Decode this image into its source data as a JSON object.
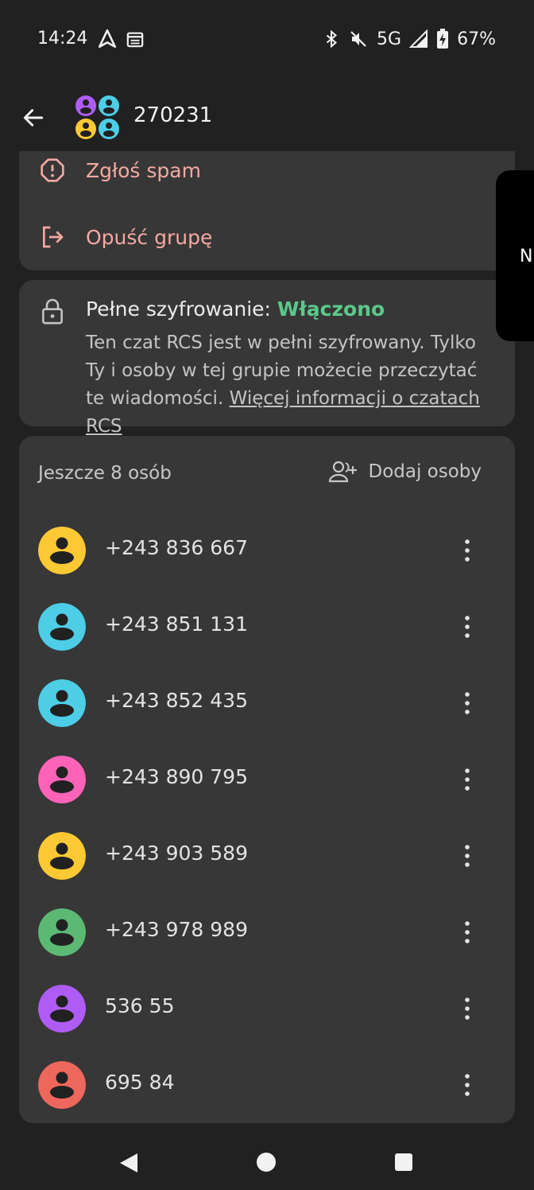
{
  "status_bar": {
    "time": "14:24",
    "network": "5G",
    "battery": "67%",
    "icons": [
      "navigation-arrow-icon",
      "calendar-icon",
      "bluetooth-icon",
      "vibrate-off-icon",
      "signal-icon",
      "battery-charging-icon"
    ]
  },
  "app_bar": {
    "title": "270231",
    "back_icon": "arrow-left-icon"
  },
  "menu": {
    "report_spam": "Zgłoś spam",
    "leave_group": "Opuść grupę"
  },
  "encryption": {
    "title": "Pełne szyfrowanie: ",
    "status": "Włączono",
    "description": "Ten czat RCS jest w pełni szyfrowany. Tylko Ty i osoby w tej grupie możecie przeczytać te wiadomości. ",
    "link": "Więcej informacji o czatach RCS"
  },
  "members": {
    "header": "Jeszcze 8 osób",
    "add_label": "Dodaj osoby",
    "list": [
      {
        "number": "+243 836 667",
        "color": "#FCC934"
      },
      {
        "number": "+243 851 131",
        "color": "#4ECDE6"
      },
      {
        "number": "+243 852 435",
        "color": "#4ECDE6"
      },
      {
        "number": "+243 890 795",
        "color": "#FF63B8"
      },
      {
        "number": "+243 903 589",
        "color": "#FCC934"
      },
      {
        "number": "+243 978 989",
        "color": "#5BB974"
      },
      {
        "number": "536 55",
        "color": "#AF5CF7"
      },
      {
        "number": "695 84",
        "color": "#EE675C"
      }
    ]
  },
  "side_panel": {
    "label": "N"
  },
  "colors": {
    "background": "#212121",
    "card": "#373737",
    "accent_red": "#F4A9A1",
    "accent_green": "#5BC98B"
  }
}
